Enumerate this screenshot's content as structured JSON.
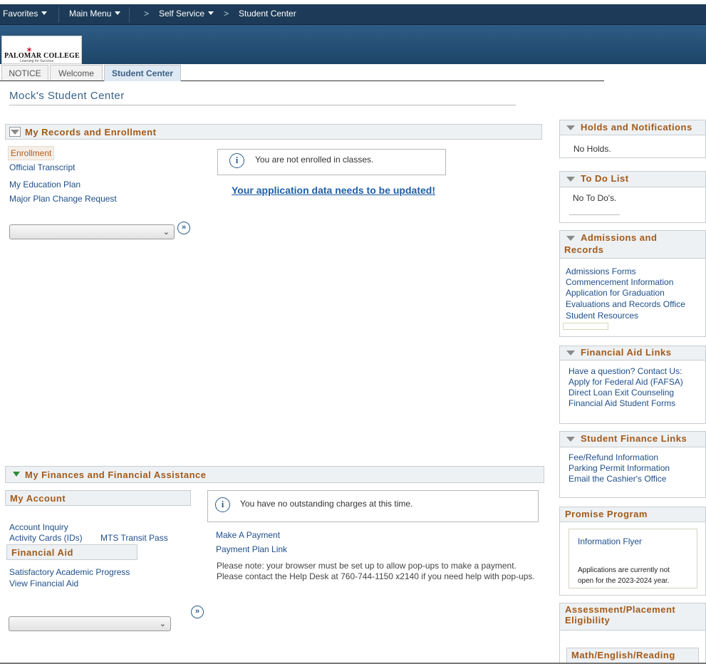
{
  "topnav": {
    "favorites": "Favorites",
    "main_menu": "Main Menu",
    "breadcrumb_self_service": "Self Service",
    "breadcrumb_current": "Student Center",
    "breadcrumb_separator": ">"
  },
  "logo": {
    "name": "PALOMAR COLLEGE",
    "tagline": "Learning for Success"
  },
  "tabs": [
    {
      "label": "NOTICE",
      "active": false
    },
    {
      "label": "Welcome",
      "active": false
    },
    {
      "label": "Student Center",
      "active": true
    }
  ],
  "page_title": "Mock's Student Center",
  "records": {
    "header": "My Records and Enrollment",
    "links": [
      "Enrollment",
      "Official Transcript",
      "My Education Plan",
      "Major Plan Change Request"
    ],
    "select_value": "",
    "enroll_message": "You are not enrolled in classes.",
    "app_warning": "Your application data needs to be updated!"
  },
  "finances": {
    "header": "My Finances and Financial Assistance",
    "my_account_header": "My Account",
    "account_links": [
      "Account Inquiry",
      "Activity Cards (IDs)",
      "MTS Transit Pass"
    ],
    "financial_aid_header": "Financial Aid",
    "aid_links": [
      "Satisfactory Academic Progress",
      "View Financial Aid"
    ],
    "charges_message": "You have no outstanding charges at this time.",
    "payment_links": [
      "Make A Payment",
      "Payment Plan Link"
    ],
    "note_line1": "Please note: your browser must be set up to allow pop-ups to make a payment.",
    "note_line2": "Please contact the Help Desk at 760-744-1150 x2140 if you need help with pop-ups.",
    "select_value": ""
  },
  "sidebar": {
    "holds": {
      "header": "Holds and Notifications",
      "text": "No Holds."
    },
    "todo": {
      "header": "To Do List",
      "text": "No To Do's."
    },
    "admissions": {
      "header_line1": "Admissions and",
      "header_line2": "Records",
      "links": [
        "Admissions Forms",
        "Commencement Information",
        "Application for Graduation",
        "Evaluations and Records Office",
        "Student Resources"
      ]
    },
    "fin_aid_links": {
      "header": "Financial Aid Links",
      "links": [
        "Have a question? Contact Us:",
        "Apply for Federal Aid (FAFSA)",
        "Direct Loan Exit Counseling",
        "Financial Aid Student Forms"
      ]
    },
    "student_finance": {
      "header": "Student Finance Links",
      "links": [
        "Fee/Refund Information",
        "Parking Permit Information",
        "Email the Cashier's Office"
      ]
    },
    "promise": {
      "header": "Promise Program",
      "link": "Information Flyer",
      "note_line1": "Applications are currently not",
      "note_line2": "open for the 2023-2024 year."
    },
    "assessment": {
      "header_line1": "Assessment/Placement",
      "header_line2": "Eligibility",
      "sub_header": "Math/English/Reading"
    }
  },
  "colors": {
    "nav_bg": "#1d3b58",
    "section_title": "#a25a1a",
    "link": "#1f4f8b",
    "page_title": "#3a6287"
  },
  "icons": {
    "go": "double-chevron-right-icon",
    "info": "info-circle-icon"
  }
}
